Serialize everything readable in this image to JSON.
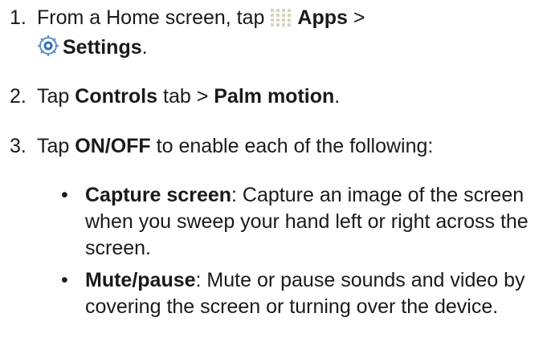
{
  "steps": [
    {
      "number": "1.",
      "text_a": "From a Home screen, tap ",
      "apps_label": "Apps",
      "sep": " >",
      "settings_label": "Settings",
      "end": "."
    },
    {
      "number": "2.",
      "text_a": "Tap ",
      "controls_label": "Controls",
      "text_b": " tab > ",
      "palm_label": "Palm motion",
      "end": "."
    },
    {
      "number": "3.",
      "text_a": "Tap ",
      "onoff_label": "ON/OFF",
      "text_b": " to enable each of the following:"
    }
  ],
  "bullets": [
    {
      "marker": "•",
      "term": "Capture screen",
      "colon": ":",
      "desc": " Capture an image of the screen when you sweep your hand left or right across the screen."
    },
    {
      "marker": "•",
      "term": "Mute/pause",
      "colon": ":",
      "desc": " Mute or pause sounds and video by covering the screen or turning over the device."
    }
  ],
  "icons": {
    "apps": "apps-grid-icon",
    "settings": "settings-gear-icon"
  },
  "colors": {
    "text": "#1a1a1a",
    "apps_icon": "#d6d4ba",
    "settings_icon_ring": "#5b8fc9",
    "settings_icon_center": "#2f6fb5"
  }
}
